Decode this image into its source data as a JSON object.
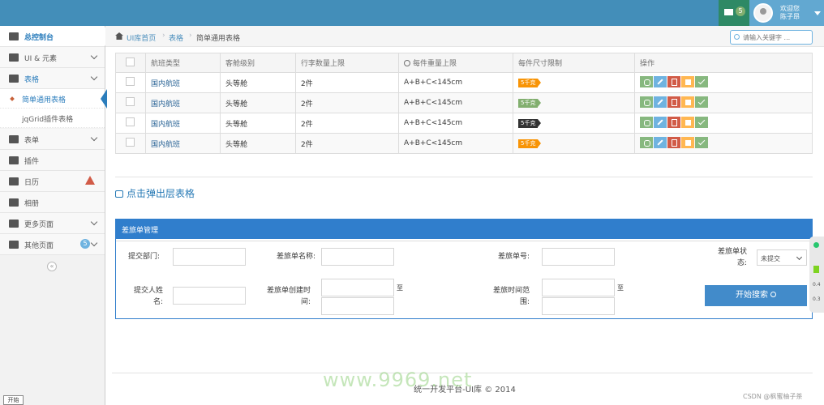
{
  "topbar": {
    "msg_count": "5",
    "welcome_line1": "欢迎您",
    "welcome_line2": "陈子昂"
  },
  "sidebar": {
    "items": [
      {
        "label": "总控制台",
        "icon": "dashboard-icon"
      },
      {
        "label": "UI & 元素",
        "icon": "desktop-icon"
      },
      {
        "label": "表格",
        "icon": "list-icon"
      },
      {
        "label": "表单",
        "icon": "edit-icon"
      },
      {
        "label": "插件",
        "icon": "list-alt-icon"
      },
      {
        "label": "日历",
        "icon": "calendar-icon"
      },
      {
        "label": "相册",
        "icon": "picture-icon"
      },
      {
        "label": "更多页面",
        "icon": "tag-icon"
      },
      {
        "label": "其他页面",
        "icon": "file-icon",
        "badge": "5"
      }
    ],
    "sub_items": [
      {
        "label": "简单通用表格"
      },
      {
        "label": "jqGrid插件表格"
      }
    ],
    "collapse": "«"
  },
  "breadcrumb": {
    "items": [
      "UI库首页",
      "表格",
      "简单通用表格"
    ],
    "search_placeholder": "请输入关键字 ..."
  },
  "table": {
    "headers": [
      "航班类型",
      "客舱级别",
      "行李数量上限",
      "每件尺寸限制",
      "每件重量上限",
      "操作"
    ],
    "rows": [
      {
        "type": "国内航班",
        "cabin": "头等舱",
        "count": "2件",
        "size": "A+B+C<145cm",
        "weight": "5千克",
        "weight_color": "orange"
      },
      {
        "type": "国内航班",
        "cabin": "头等舱",
        "count": "2件",
        "size": "A+B+C<145cm",
        "weight": "5千克",
        "weight_color": "green"
      },
      {
        "type": "国内航班",
        "cabin": "头等舱",
        "count": "2件",
        "size": "A+B+C<145cm",
        "weight": "5千克",
        "weight_color": "black"
      },
      {
        "type": "国内航班",
        "cabin": "头等舱",
        "count": "2件",
        "size": "A+B+C<145cm",
        "weight": "5千克",
        "weight_color": "orange"
      }
    ]
  },
  "popup_link": "点击弹出层表格",
  "panel": {
    "title": "差旅单管理",
    "dept_label": "提交部门:",
    "name_label": "差旅单名称:",
    "no_label": "差旅单号:",
    "status_label_1": "差旅单状",
    "status_label_2": "态:",
    "status_value": "未提交",
    "submitter_label_1": "提交人姓",
    "submitter_label_2": "名:",
    "created_label_1": "差旅单创建时",
    "created_label_2": "间:",
    "range_label_1": "差旅时间范",
    "range_label_2": "围:",
    "to": "至",
    "search_button": "开始搜索"
  },
  "footer": "统一开发平台-UI库 © 2014",
  "watermark": "www.9969.net",
  "credit": "CSDN @枫蜜柚子茶",
  "start": "开始",
  "float_bar": {
    "v1": "0.4",
    "v2": "0.3"
  },
  "colors": {
    "topbar": "#438eb9",
    "accent": "#2b7dbc",
    "panel": "#307ecc"
  }
}
